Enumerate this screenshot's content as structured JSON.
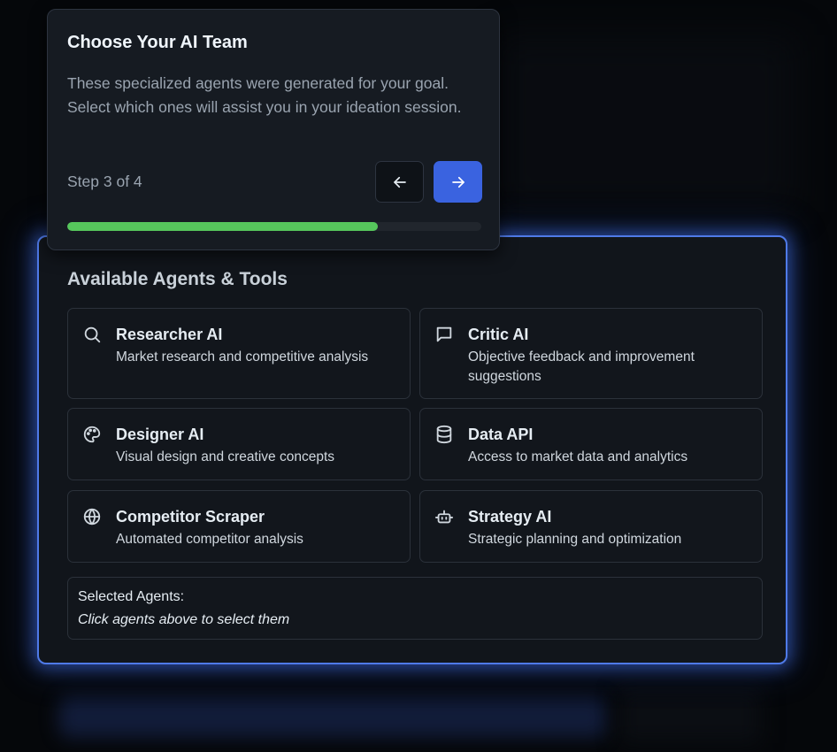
{
  "tour": {
    "title": "Choose Your AI Team",
    "body": "These specialized agents were generated for your goal. Select which ones will assist you in your ideation session.",
    "step_text": "Step 3 of 4",
    "progress": 0.75,
    "prev_icon": "arrow-left-icon",
    "next_icon": "arrow-right-icon",
    "accent_color": "#3a63e0",
    "progress_color": "#56c65c"
  },
  "panel": {
    "title": "Available Agents & Tools",
    "border_color": "#4f7ae8",
    "agents": [
      {
        "name": "Researcher AI",
        "description": "Market research and competitive analysis",
        "icon": "search-icon"
      },
      {
        "name": "Critic AI",
        "description": "Objective feedback and improvement suggestions",
        "icon": "message-square-icon"
      },
      {
        "name": "Designer AI",
        "description": "Visual design and creative concepts",
        "icon": "palette-icon"
      },
      {
        "name": "Data API",
        "description": "Access to market data and analytics",
        "icon": "database-icon"
      },
      {
        "name": "Competitor Scraper",
        "description": "Automated competitor analysis",
        "icon": "globe-icon"
      },
      {
        "name": "Strategy AI",
        "description": "Strategic planning and optimization",
        "icon": "bot-icon"
      }
    ],
    "selected_label": "Selected Agents:",
    "selected_hint": "Click agents above to select them"
  }
}
